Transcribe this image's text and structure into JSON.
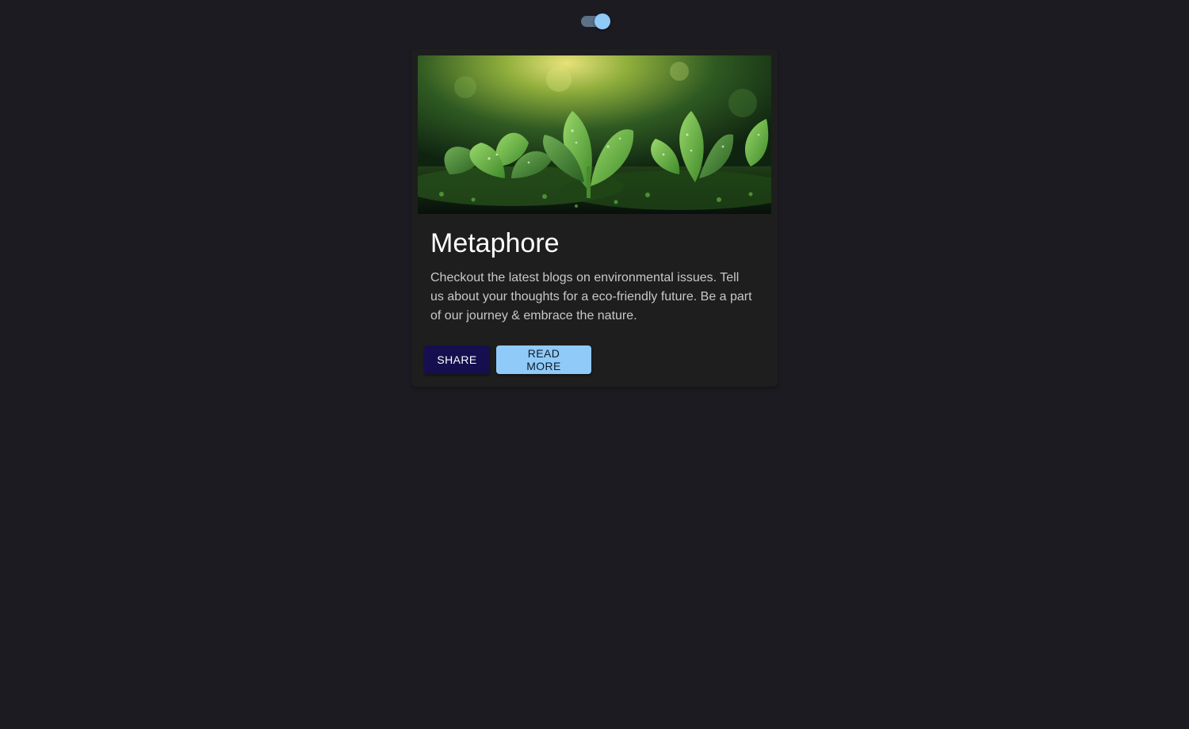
{
  "theme_toggle": {
    "state": "on",
    "icon": "toggle-switch-icon",
    "thumb_color": "#90caf9",
    "track_color": "#5c7186"
  },
  "card": {
    "image": {
      "description_icon": "plant-seedlings-image"
    },
    "title": "Metaphore",
    "text": "Checkout the latest blogs on environmental issues. Tell us about your thoughts for a eco-friendly future. Be a part of our journey & embrace the nature.",
    "actions": {
      "share_label": "SHARE",
      "read_more_label": "READ MORE"
    }
  },
  "colors": {
    "background": "#1c1b21",
    "card": "#1e1e1e",
    "share_button": "#160f4f",
    "read_more_button": "#90caf9"
  }
}
